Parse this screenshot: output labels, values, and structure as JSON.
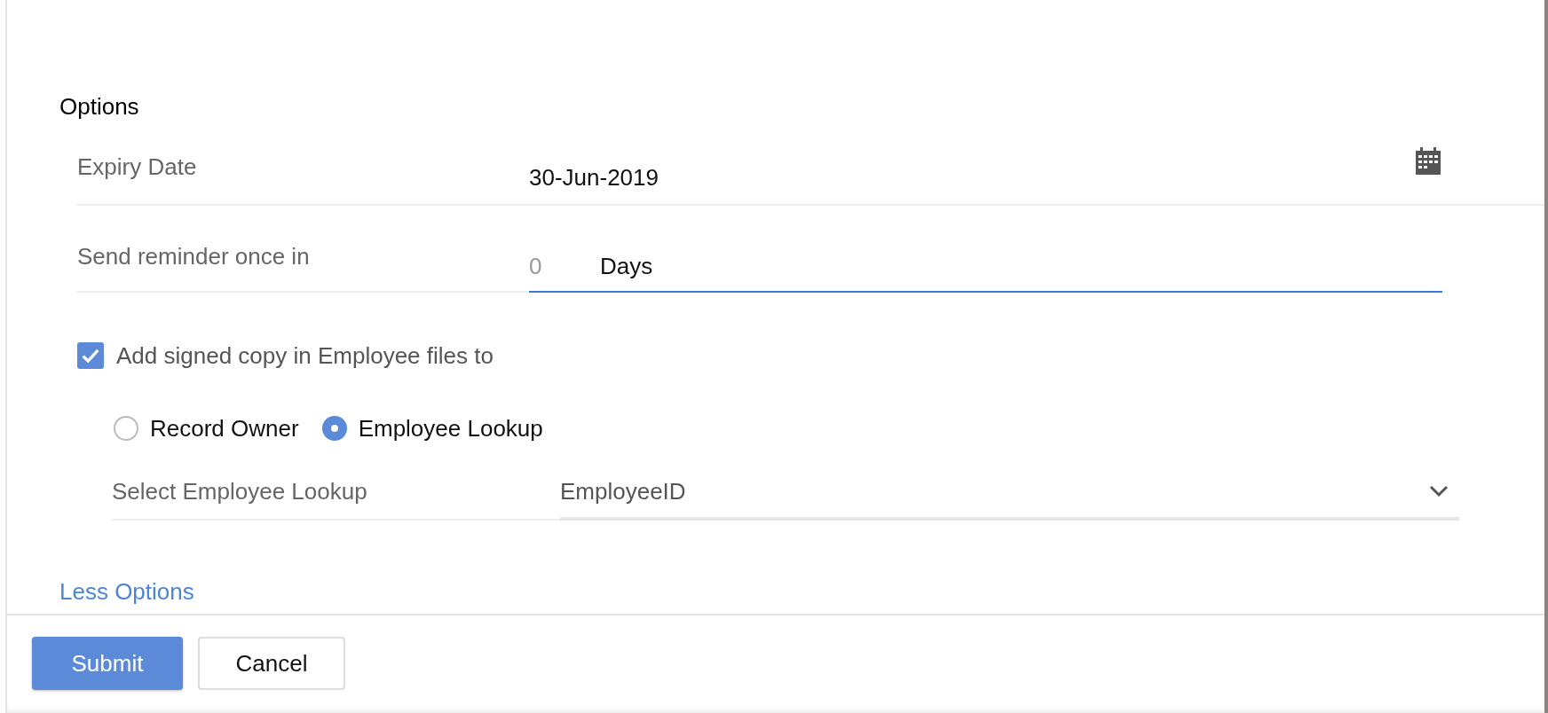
{
  "section_title": "Options",
  "expiry": {
    "label": "Expiry Date",
    "value": "30-Jun-2019"
  },
  "reminder": {
    "label": "Send reminder once in",
    "placeholder": "0",
    "unit": "Days",
    "focused": true
  },
  "add_signed_copy": {
    "label": "Add signed copy in Employee files to",
    "checked": true
  },
  "recipients": [
    {
      "label": "Record Owner",
      "selected": false
    },
    {
      "label": "Employee Lookup",
      "selected": true
    }
  ],
  "lookup": {
    "label": "Select Employee Lookup",
    "value": "EmployeeID"
  },
  "less_options": "Less Options",
  "buttons": [
    {
      "label": "Submit",
      "kind": "primary"
    },
    {
      "label": "Cancel",
      "kind": "secondary"
    }
  ]
}
